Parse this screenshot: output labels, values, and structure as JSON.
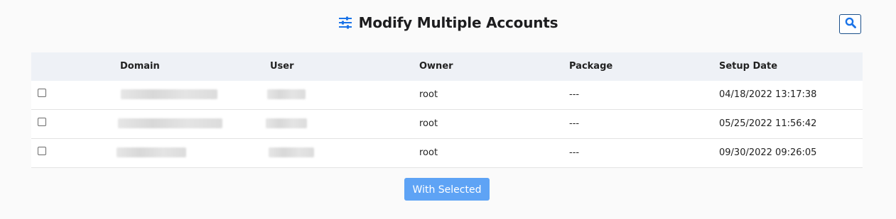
{
  "header": {
    "title": "Modify Multiple Accounts",
    "title_icon": "sliders-icon",
    "search_icon": "search-icon"
  },
  "table": {
    "columns": [
      "Domain",
      "User",
      "Owner",
      "Package",
      "Setup Date"
    ],
    "rows": [
      {
        "domain": "",
        "user": "",
        "owner": "root",
        "package": "---",
        "setup_date": "04/18/2022 13:17:38"
      },
      {
        "domain": "",
        "user": "",
        "owner": "root",
        "package": "---",
        "setup_date": "05/25/2022 11:56:42"
      },
      {
        "domain": "",
        "user": "",
        "owner": "root",
        "package": "---",
        "setup_date": "09/30/2022 09:26:05"
      }
    ]
  },
  "actions": {
    "with_selected_label": "With Selected"
  },
  "colors": {
    "accent": "#1a73e8",
    "button": "#5ea3f5",
    "header_bg": "#eef1f6"
  }
}
